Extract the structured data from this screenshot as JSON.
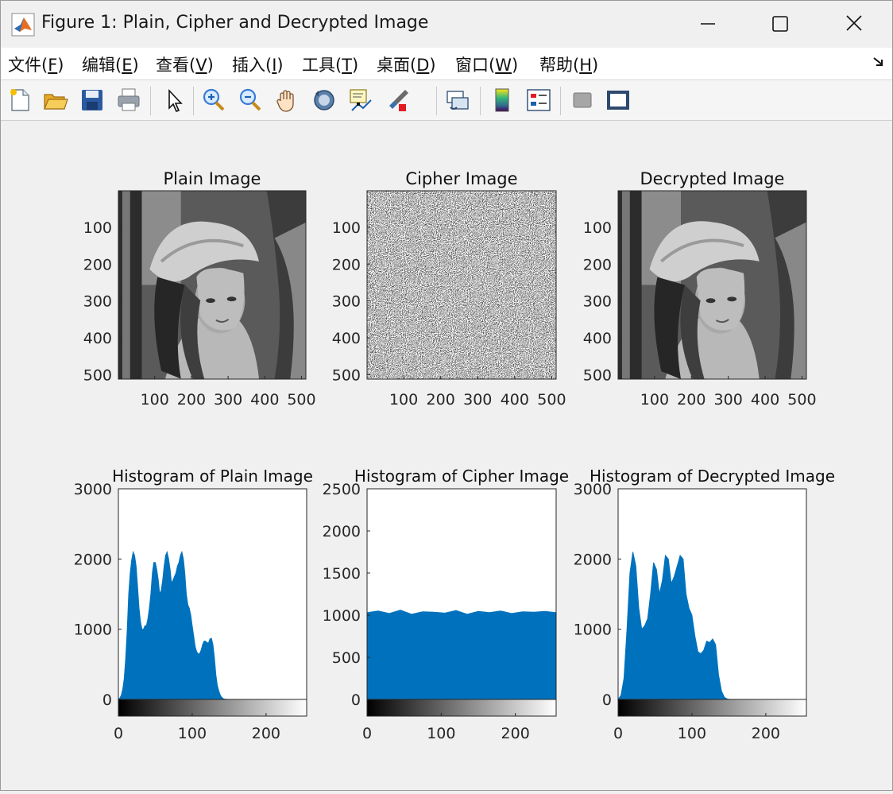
{
  "window": {
    "title": "Figure 1: Plain, Cipher and Decrypted Image"
  },
  "menu": [
    {
      "label": "文件(",
      "key": "F",
      "end": ")"
    },
    {
      "label": "编辑(",
      "key": "E",
      "end": ")"
    },
    {
      "label": "查看(",
      "key": "V",
      "end": ")"
    },
    {
      "label": "插入(",
      "key": "I",
      "end": ")"
    },
    {
      "label": "工具(",
      "key": "T",
      "end": ")"
    },
    {
      "label": "桌面(",
      "key": "D",
      "end": ")"
    },
    {
      "label": "窗口(",
      "key": "W",
      "end": ")"
    },
    {
      "label": "帮助(",
      "key": "H",
      "end": ")"
    }
  ],
  "toolbar_icons": [
    "new-figure-icon",
    "open-file-icon",
    "save-icon",
    "print-icon",
    "pointer-icon",
    "zoom-in-icon",
    "zoom-out-icon",
    "pan-hand-icon",
    "rotate-3d-icon",
    "data-cursor-icon",
    "brush-icon",
    "brush-dropdown-icon",
    "link-plot-icon",
    "colorbar-icon",
    "legend-icon",
    "hide-plot-tools-icon",
    "show-plot-tools-icon"
  ],
  "chart_data": [
    {
      "type": "image",
      "title": "Plain Image",
      "image": "grayscale photo (Lena)",
      "xticks": [
        "100",
        "200",
        "300",
        "400",
        "500"
      ],
      "yticks": [
        "100",
        "200",
        "300",
        "400",
        "500"
      ],
      "xlim": [
        1,
        512
      ],
      "ylim": [
        1,
        512
      ]
    },
    {
      "type": "image",
      "title": "Cipher Image",
      "image": "random noise",
      "xticks": [
        "100",
        "200",
        "300",
        "400",
        "500"
      ],
      "yticks": [
        "100",
        "200",
        "300",
        "400",
        "500"
      ],
      "xlim": [
        1,
        512
      ],
      "ylim": [
        1,
        512
      ]
    },
    {
      "type": "image",
      "title": "Decrypted Image",
      "image": "grayscale photo (Lena)",
      "xticks": [
        "100",
        "200",
        "300",
        "400",
        "500"
      ],
      "yticks": [
        "100",
        "200",
        "300",
        "400",
        "500"
      ],
      "xlim": [
        1,
        512
      ],
      "ylim": [
        1,
        512
      ]
    },
    {
      "type": "area",
      "title": "Histogram of Plain Image",
      "xticks": [
        "0",
        "100",
        "200"
      ],
      "yticks": [
        "0",
        "1000",
        "2000",
        "3000"
      ],
      "xlim": [
        0,
        255
      ],
      "ylim": [
        0,
        3000
      ],
      "color": "#0072bd",
      "x": [
        0,
        2,
        4,
        6,
        8,
        10,
        12,
        14,
        16,
        18,
        20,
        22,
        24,
        26,
        28,
        30,
        32,
        34,
        36,
        38,
        40,
        42,
        44,
        46,
        48,
        50,
        52,
        54,
        56,
        58,
        60,
        62,
        64,
        66,
        68,
        70,
        72,
        74,
        76,
        78,
        80,
        82,
        84,
        86,
        88,
        90,
        92,
        94,
        96,
        98,
        100,
        102,
        104,
        106,
        108,
        110,
        112,
        114,
        116,
        118,
        120,
        122,
        124,
        126,
        128,
        130,
        132,
        134,
        136,
        138,
        140,
        142,
        144,
        146,
        148,
        150,
        152,
        154,
        156,
        158,
        160,
        162,
        164,
        166,
        168,
        170,
        172,
        174,
        176,
        178,
        180,
        182,
        184,
        186,
        188,
        190,
        192,
        194,
        196,
        198,
        200,
        202,
        204,
        206,
        208,
        210,
        212,
        214,
        216,
        218,
        220,
        225,
        230,
        240,
        255
      ],
      "values": [
        0,
        20,
        60,
        150,
        300,
        600,
        1000,
        1500,
        1800,
        1980,
        2100,
        2050,
        1900,
        1600,
        1300,
        1100,
        1000,
        1000,
        1050,
        1050,
        1150,
        1300,
        1500,
        1800,
        1950,
        1950,
        1850,
        1700,
        1500,
        1550,
        1700,
        1900,
        2050,
        2100,
        2000,
        1850,
        1650,
        1700,
        1750,
        1800,
        1900,
        1950,
        2050,
        2100,
        2000,
        1800,
        1500,
        1350,
        1300,
        1200,
        1050,
        900,
        750,
        680,
        650,
        650,
        700,
        780,
        830,
        830,
        810,
        800,
        860,
        870,
        780,
        600,
        350,
        200,
        120,
        60,
        30,
        10,
        5,
        2,
        0,
        0,
        0,
        0,
        0,
        0,
        0,
        0,
        0,
        0,
        0,
        0,
        0,
        0,
        0,
        0,
        0,
        0,
        0,
        0,
        0,
        0,
        0,
        0,
        0,
        0,
        0,
        0,
        0,
        0,
        0,
        0,
        0,
        0,
        0,
        0,
        0,
        0,
        0,
        0,
        0
      ]
    },
    {
      "type": "area",
      "title": "Histogram of Cipher Image",
      "xticks": [
        "0",
        "100",
        "200"
      ],
      "yticks": [
        "0",
        "500",
        "1000",
        "1500",
        "2000",
        "2500"
      ],
      "xlim": [
        0,
        255
      ],
      "ylim": [
        0,
        2500
      ],
      "color": "#0072bd",
      "x": [
        0,
        15,
        30,
        45,
        60,
        75,
        90,
        105,
        120,
        135,
        150,
        165,
        180,
        195,
        210,
        225,
        240,
        255
      ],
      "values": [
        1030,
        1050,
        1020,
        1060,
        1010,
        1040,
        1035,
        1025,
        1055,
        1010,
        1045,
        1030,
        1050,
        1020,
        1040,
        1035,
        1045,
        1030
      ]
    },
    {
      "type": "area",
      "title": "Histogram of Decrypted Image",
      "xticks": [
        "0",
        "100",
        "200"
      ],
      "yticks": [
        "0",
        "1000",
        "2000",
        "3000"
      ],
      "xlim": [
        0,
        255
      ],
      "ylim": [
        0,
        3000
      ],
      "color": "#0072bd",
      "x": [
        0,
        4,
        8,
        12,
        16,
        20,
        24,
        28,
        32,
        36,
        40,
        44,
        48,
        52,
        56,
        60,
        64,
        68,
        72,
        76,
        80,
        84,
        88,
        92,
        96,
        100,
        104,
        108,
        112,
        116,
        120,
        124,
        128,
        132,
        136,
        140,
        144,
        148,
        152,
        156,
        160,
        164,
        168,
        172,
        176,
        180,
        184,
        188,
        192,
        196,
        200,
        204,
        208,
        212,
        216,
        220,
        224,
        228,
        232,
        236,
        240,
        244,
        248,
        252,
        255
      ],
      "values": [
        0,
        60,
        300,
        1000,
        1800,
        2100,
        1900,
        1300,
        1000,
        1050,
        1150,
        1500,
        1950,
        1850,
        1500,
        1700,
        2050,
        2000,
        1650,
        1750,
        1900,
        2050,
        2000,
        1500,
        1300,
        1200,
        900,
        680,
        650,
        700,
        830,
        810,
        860,
        780,
        350,
        120,
        30,
        5,
        0,
        0,
        0,
        0,
        0,
        0,
        0,
        0,
        0,
        0,
        0,
        0,
        0,
        0,
        0,
        0,
        0,
        0,
        0,
        0,
        0,
        0,
        0,
        0,
        0,
        0,
        0
      ]
    }
  ]
}
